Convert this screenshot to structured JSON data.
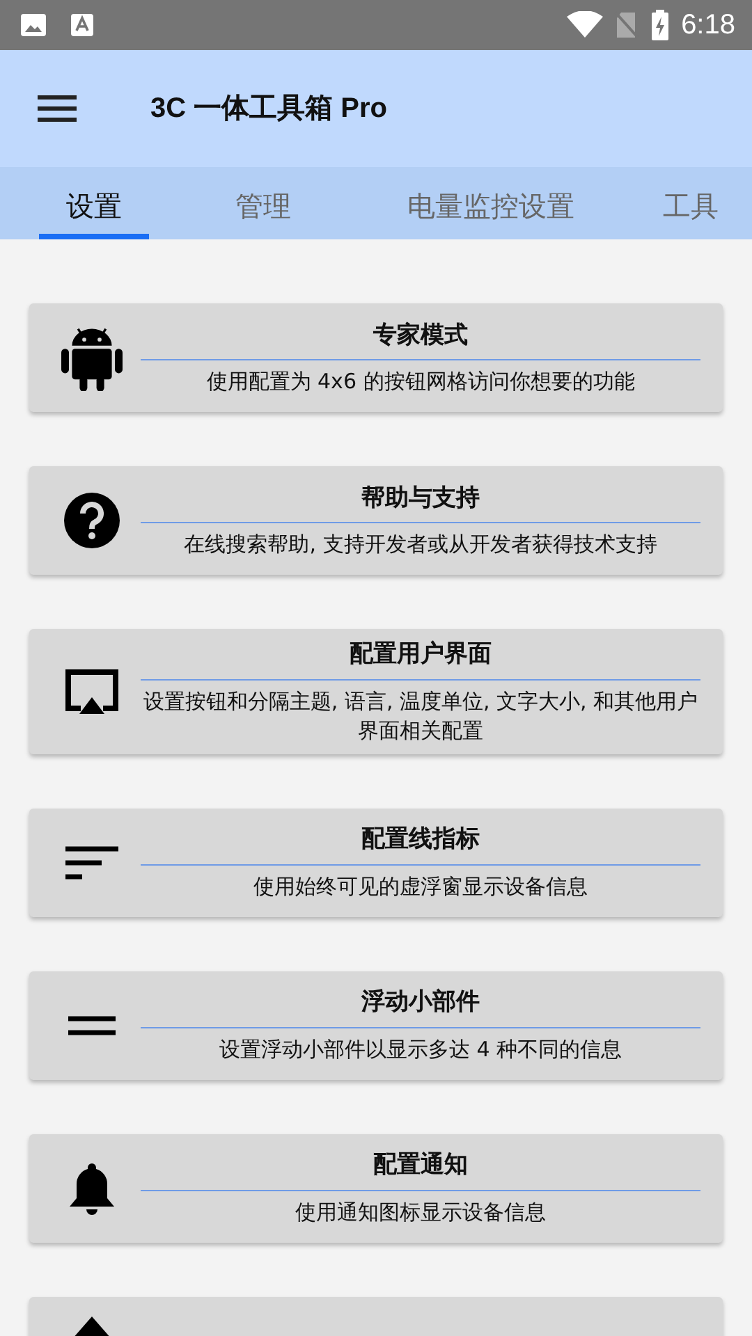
{
  "status_bar": {
    "time": "6:18"
  },
  "app_bar": {
    "title": "3C 一体工具箱 Pro"
  },
  "tabs": [
    {
      "label": "设置",
      "selected": true
    },
    {
      "label": "管理",
      "selected": false
    },
    {
      "label": "电量监控设置",
      "selected": false
    },
    {
      "label": "工具",
      "selected": false
    }
  ],
  "cards": [
    {
      "title": "专家模式",
      "description": "使用配置为 4x6 的按钮网格访问你想要的功能"
    },
    {
      "title": "帮助与支持",
      "description": "在线搜索帮助, 支持开发者或从开发者获得技术支持"
    },
    {
      "title": "配置用户界面",
      "description": "设置按钮和分隔主题, 语言, 温度单位, 文字大小, 和其他用户界面相关配置"
    },
    {
      "title": "配置线指标",
      "description": "使用始终可见的虚浮窗显示设备信息"
    },
    {
      "title": "浮动小部件",
      "description": "设置浮动小部件以显示多达 4 种不同的信息"
    },
    {
      "title": "配置通知",
      "description": "使用通知图标显示设备信息"
    },
    {
      "kind": "partial"
    }
  ]
}
